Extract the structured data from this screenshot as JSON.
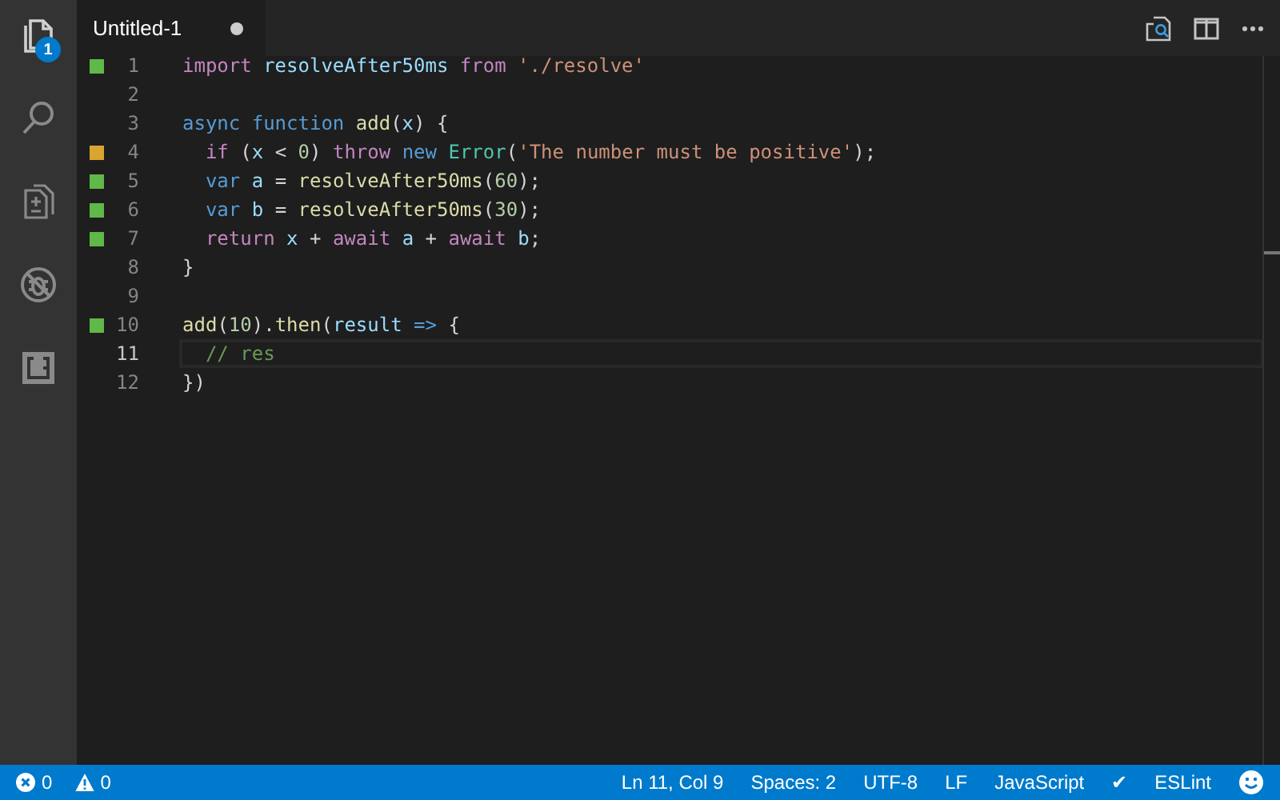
{
  "activity_bar": {
    "items": [
      {
        "kind": "files",
        "selected": true,
        "badge": "1"
      },
      {
        "kind": "search",
        "selected": false
      },
      {
        "kind": "scm",
        "selected": false
      },
      {
        "kind": "debug",
        "selected": false
      },
      {
        "kind": "extensions",
        "selected": false
      }
    ]
  },
  "tabs": [
    {
      "label": "Untitled-1",
      "selected": true,
      "modified": true
    }
  ],
  "editor": {
    "lines": [
      {
        "number": "1",
        "current": false,
        "color": "#5fb847",
        "tokens": [
          {
            "text": "import ",
            "kind": "keyword"
          },
          {
            "text": "resolveAfter50ms ",
            "kind": "variable"
          },
          {
            "text": "from ",
            "kind": "keyword"
          },
          {
            "text": "'./resolve'",
            "kind": "string"
          }
        ]
      },
      {
        "number": "2",
        "current": false
      },
      {
        "number": "3",
        "current": false,
        "tokens": [
          {
            "text": "async function ",
            "kind": "storage"
          },
          {
            "text": "add",
            "kind": "function"
          },
          {
            "text": "(",
            "kind": "plain"
          },
          {
            "text": "x",
            "kind": "variable"
          },
          {
            "text": ") {",
            "kind": "plain"
          }
        ]
      },
      {
        "number": "4",
        "current": false,
        "color": "#d9a530",
        "tokens": [
          {
            "text": "  if",
            "kind": "keyword"
          },
          {
            "text": " (",
            "kind": "plain"
          },
          {
            "text": "x",
            "kind": "variable"
          },
          {
            "text": " < ",
            "kind": "plain"
          },
          {
            "text": "0",
            "kind": "number"
          },
          {
            "text": ") ",
            "kind": "plain"
          },
          {
            "text": "throw ",
            "kind": "keyword"
          },
          {
            "text": "new ",
            "kind": "storage"
          },
          {
            "text": "Error",
            "kind": "class"
          },
          {
            "text": "(",
            "kind": "plain"
          },
          {
            "text": "'The number must be positive'",
            "kind": "string"
          },
          {
            "text": ");",
            "kind": "plain"
          }
        ]
      },
      {
        "number": "5",
        "current": false,
        "color": "#5fb847",
        "tokens": [
          {
            "text": "  var ",
            "kind": "storage"
          },
          {
            "text": "a",
            "kind": "variable"
          },
          {
            "text": " = ",
            "kind": "plain"
          },
          {
            "text": "resolveAfter50ms",
            "kind": "function"
          },
          {
            "text": "(",
            "kind": "plain"
          },
          {
            "text": "60",
            "kind": "number"
          },
          {
            "text": ");",
            "kind": "plain"
          }
        ]
      },
      {
        "number": "6",
        "current": false,
        "color": "#5fb847",
        "tokens": [
          {
            "text": "  var ",
            "kind": "storage"
          },
          {
            "text": "b",
            "kind": "variable"
          },
          {
            "text": " = ",
            "kind": "plain"
          },
          {
            "text": "resolveAfter50ms",
            "kind": "function"
          },
          {
            "text": "(",
            "kind": "plain"
          },
          {
            "text": "30",
            "kind": "number"
          },
          {
            "text": ");",
            "kind": "plain"
          }
        ]
      },
      {
        "number": "7",
        "current": false,
        "color": "#5fb847",
        "tokens": [
          {
            "text": "  return ",
            "kind": "keyword"
          },
          {
            "text": "x",
            "kind": "variable"
          },
          {
            "text": " + ",
            "kind": "plain"
          },
          {
            "text": "await ",
            "kind": "keyword"
          },
          {
            "text": "a",
            "kind": "variable"
          },
          {
            "text": " + ",
            "kind": "plain"
          },
          {
            "text": "await ",
            "kind": "keyword"
          },
          {
            "text": "b",
            "kind": "variable"
          },
          {
            "text": ";",
            "kind": "plain"
          }
        ]
      },
      {
        "number": "8",
        "current": false,
        "tokens": [
          {
            "text": "}",
            "kind": "plain"
          }
        ]
      },
      {
        "number": "9",
        "current": false
      },
      {
        "number": "10",
        "current": false,
        "color": "#5fb847",
        "tokens": [
          {
            "text": "add",
            "kind": "function"
          },
          {
            "text": "(",
            "kind": "plain"
          },
          {
            "text": "10",
            "kind": "number"
          },
          {
            "text": ").",
            "kind": "plain"
          },
          {
            "text": "then",
            "kind": "function"
          },
          {
            "text": "(",
            "kind": "plain"
          },
          {
            "text": "result ",
            "kind": "variable"
          },
          {
            "text": "=>",
            "kind": "storage"
          },
          {
            "text": " {",
            "kind": "plain"
          }
        ]
      },
      {
        "number": "11",
        "current": true,
        "tokens": [
          {
            "text": "  // res",
            "kind": "comment"
          }
        ]
      },
      {
        "number": "12",
        "current": false,
        "tokens": [
          {
            "text": "})",
            "kind": "plain"
          }
        ]
      }
    ]
  },
  "status_bar": {
    "errors": "0",
    "warnings": "0",
    "items": [
      "Ln 11, Col 9",
      "Spaces: 2",
      "UTF-8",
      "LF",
      "JavaScript",
      "✔",
      "ESLint"
    ]
  }
}
